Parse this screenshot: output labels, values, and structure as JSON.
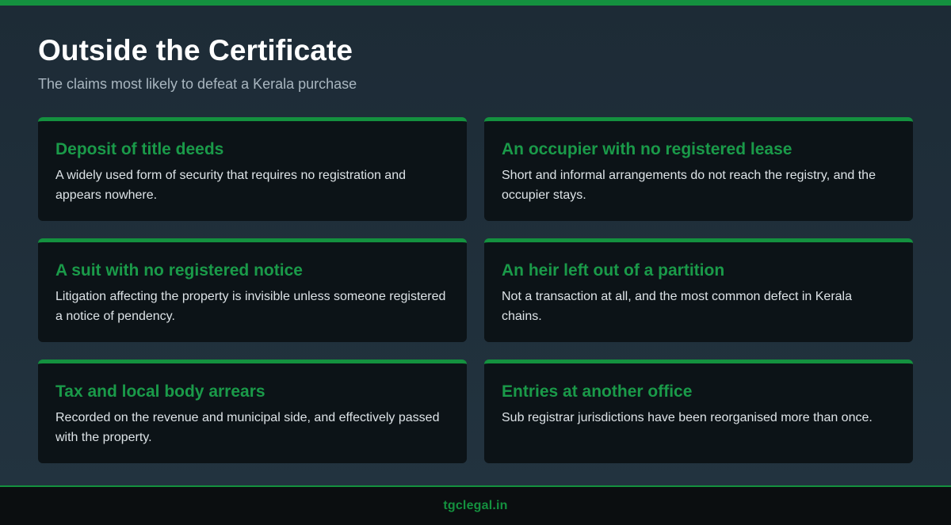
{
  "header": {
    "title": "Outside the Certificate",
    "subtitle": "The claims most likely to defeat a Kerala purchase"
  },
  "cards": [
    {
      "title": "Deposit of title deeds",
      "body": "A widely used form of security that requires no registration and appears nowhere."
    },
    {
      "title": "An occupier with no registered lease",
      "body": "Short and informal arrangements do not reach the registry, and the occupier stays."
    },
    {
      "title": "A suit with no registered notice",
      "body": "Litigation affecting the property is invisible unless someone registered a notice of pendency."
    },
    {
      "title": "An heir left out of a partition",
      "body": "Not a transaction at all, and the most common defect in Kerala chains."
    },
    {
      "title": "Tax and local body arrears",
      "body": "Recorded on the revenue and municipal side, and effectively passed with the property."
    },
    {
      "title": "Entries at another office",
      "body": "Sub registrar jurisdictions have been reorganised more than once."
    }
  ],
  "footer": {
    "text": "tgclegal.in"
  },
  "colors": {
    "accent": "#14913f",
    "card_title": "#1a9a49",
    "card_background": "#0c1317",
    "page_background": "#1f2d38"
  }
}
